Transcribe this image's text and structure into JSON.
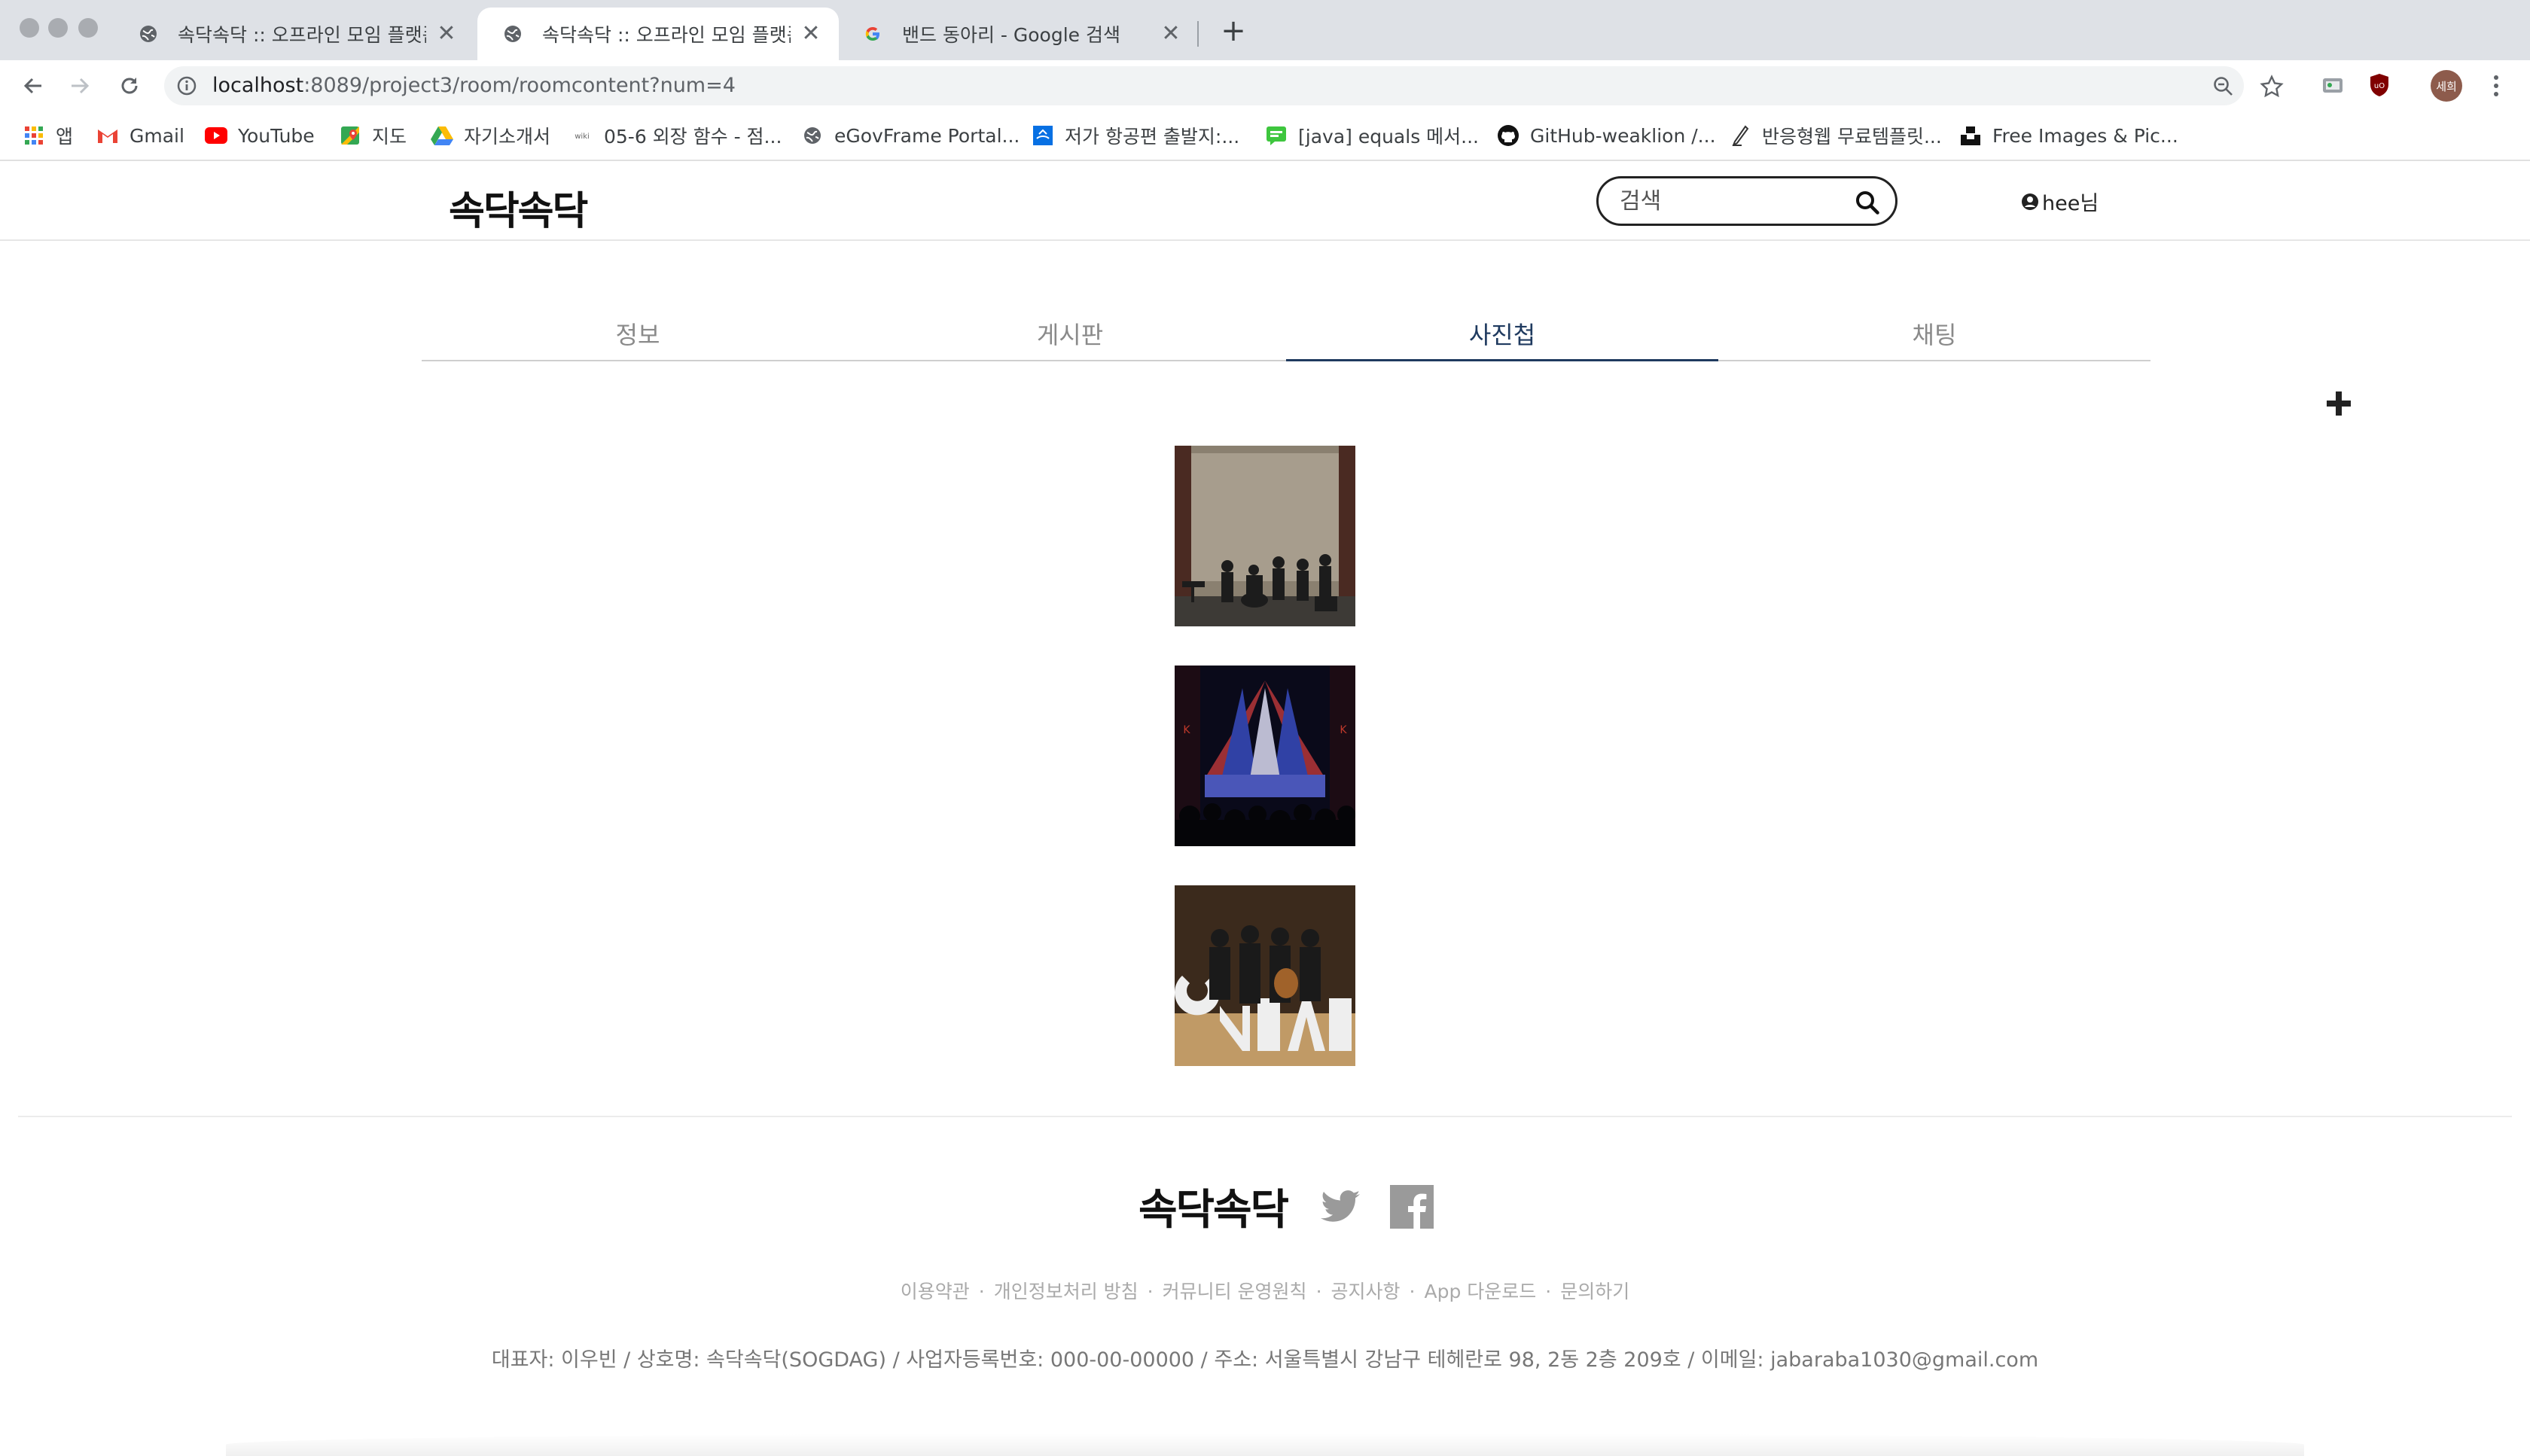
{
  "browser": {
    "tabs": [
      {
        "title": "속닥속닥 :: 오프라인 모임 플랫폼",
        "active": false
      },
      {
        "title": "속닥속닥 :: 오프라인 모임 플랫폼",
        "active": true
      },
      {
        "title": "밴드 동아리 - Google 검색",
        "active": false
      }
    ],
    "tab_close_glyph": "✕",
    "new_tab_glyph": "+",
    "url_host": "localhost",
    "url_path": ":8089/project3/room/roomcontent?num=4",
    "profile_initials": "세희",
    "bookmarks": [
      {
        "label": "앱",
        "icon": "apps-grid-icon"
      },
      {
        "label": "Gmail",
        "icon": "gmail-icon"
      },
      {
        "label": "YouTube",
        "icon": "youtube-icon"
      },
      {
        "label": "지도",
        "icon": "maps-icon"
      },
      {
        "label": "자기소개서",
        "icon": "drive-icon"
      },
      {
        "label": "05-6 외장 함수 - 점...",
        "icon": "wikidocs-icon"
      },
      {
        "label": "eGovFrame Portal...",
        "icon": "globe-icon"
      },
      {
        "label": "저가 항공편 출발지:...",
        "icon": "flight-icon"
      },
      {
        "label": "[java] equals 메서...",
        "icon": "chat-icon"
      },
      {
        "label": "GitHub-weaklion /...",
        "icon": "github-icon"
      },
      {
        "label": "반응형웹 무료템플릿...",
        "icon": "pen-icon"
      },
      {
        "label": "Free Images & Pic...",
        "icon": "unsplash-icon"
      }
    ]
  },
  "header": {
    "logo": "속닥속닥",
    "search_placeholder": "검색",
    "user_label": "hee님"
  },
  "room_tabs": [
    {
      "label": "정보",
      "active": false
    },
    {
      "label": "게시판",
      "active": false
    },
    {
      "label": "사진첩",
      "active": true
    },
    {
      "label": "채팅",
      "active": false
    }
  ],
  "gallery": {
    "add_icon": "plus-icon",
    "photos": [
      "band-stage-photo",
      "concert-lights-photo",
      "band-group-photo"
    ]
  },
  "footer": {
    "logo": "속닥속닥",
    "links": [
      "이용약관",
      "개인정보처리 방침",
      "커뮤니티 운영원칙",
      "공지사항",
      "App 다운로드",
      "문의하기"
    ],
    "separator": "·",
    "company_info": "대표자: 이우빈 / 상호명: 속닥속닥(SOGDAG) / 사업자등록번호: 000-00-00000 / 주소: 서울특별시 강남구 테헤란로 98, 2동 2층 209호 / 이메일: jabaraba1030@gmail.com"
  },
  "colors": {
    "active_tab": "#1f3a5f",
    "inactive_tab": "#8a8a8a",
    "tabstrip_bg": "#dee1e6",
    "omnibox_bg": "#f1f3f4"
  }
}
